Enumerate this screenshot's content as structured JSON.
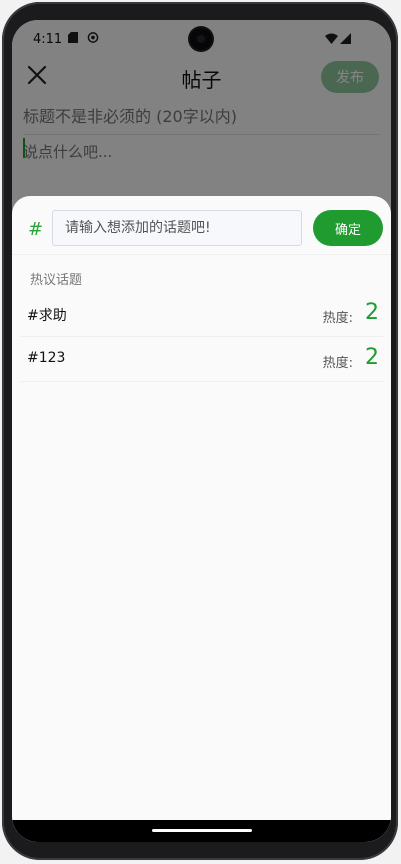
{
  "status_bar": {
    "time": "4:11"
  },
  "header": {
    "title": "帖子",
    "publish_label": "发布"
  },
  "editor": {
    "title_placeholder": "标题不是非必须的 (20字以内)",
    "body_placeholder": "说点什么吧..."
  },
  "topic_sheet": {
    "hash_symbol": "#",
    "input_placeholder": "请输入想添加的话题吧!",
    "confirm_label": "确定",
    "section_title": "热议话题",
    "topics": [
      {
        "name": "#求助",
        "heat_label": "热度:",
        "heat_value": "2"
      },
      {
        "name": "#123",
        "heat_label": "热度:",
        "heat_value": "2"
      }
    ]
  },
  "colors": {
    "accent": "#1f9b2f",
    "publish_disabled": "#8fc79c"
  }
}
